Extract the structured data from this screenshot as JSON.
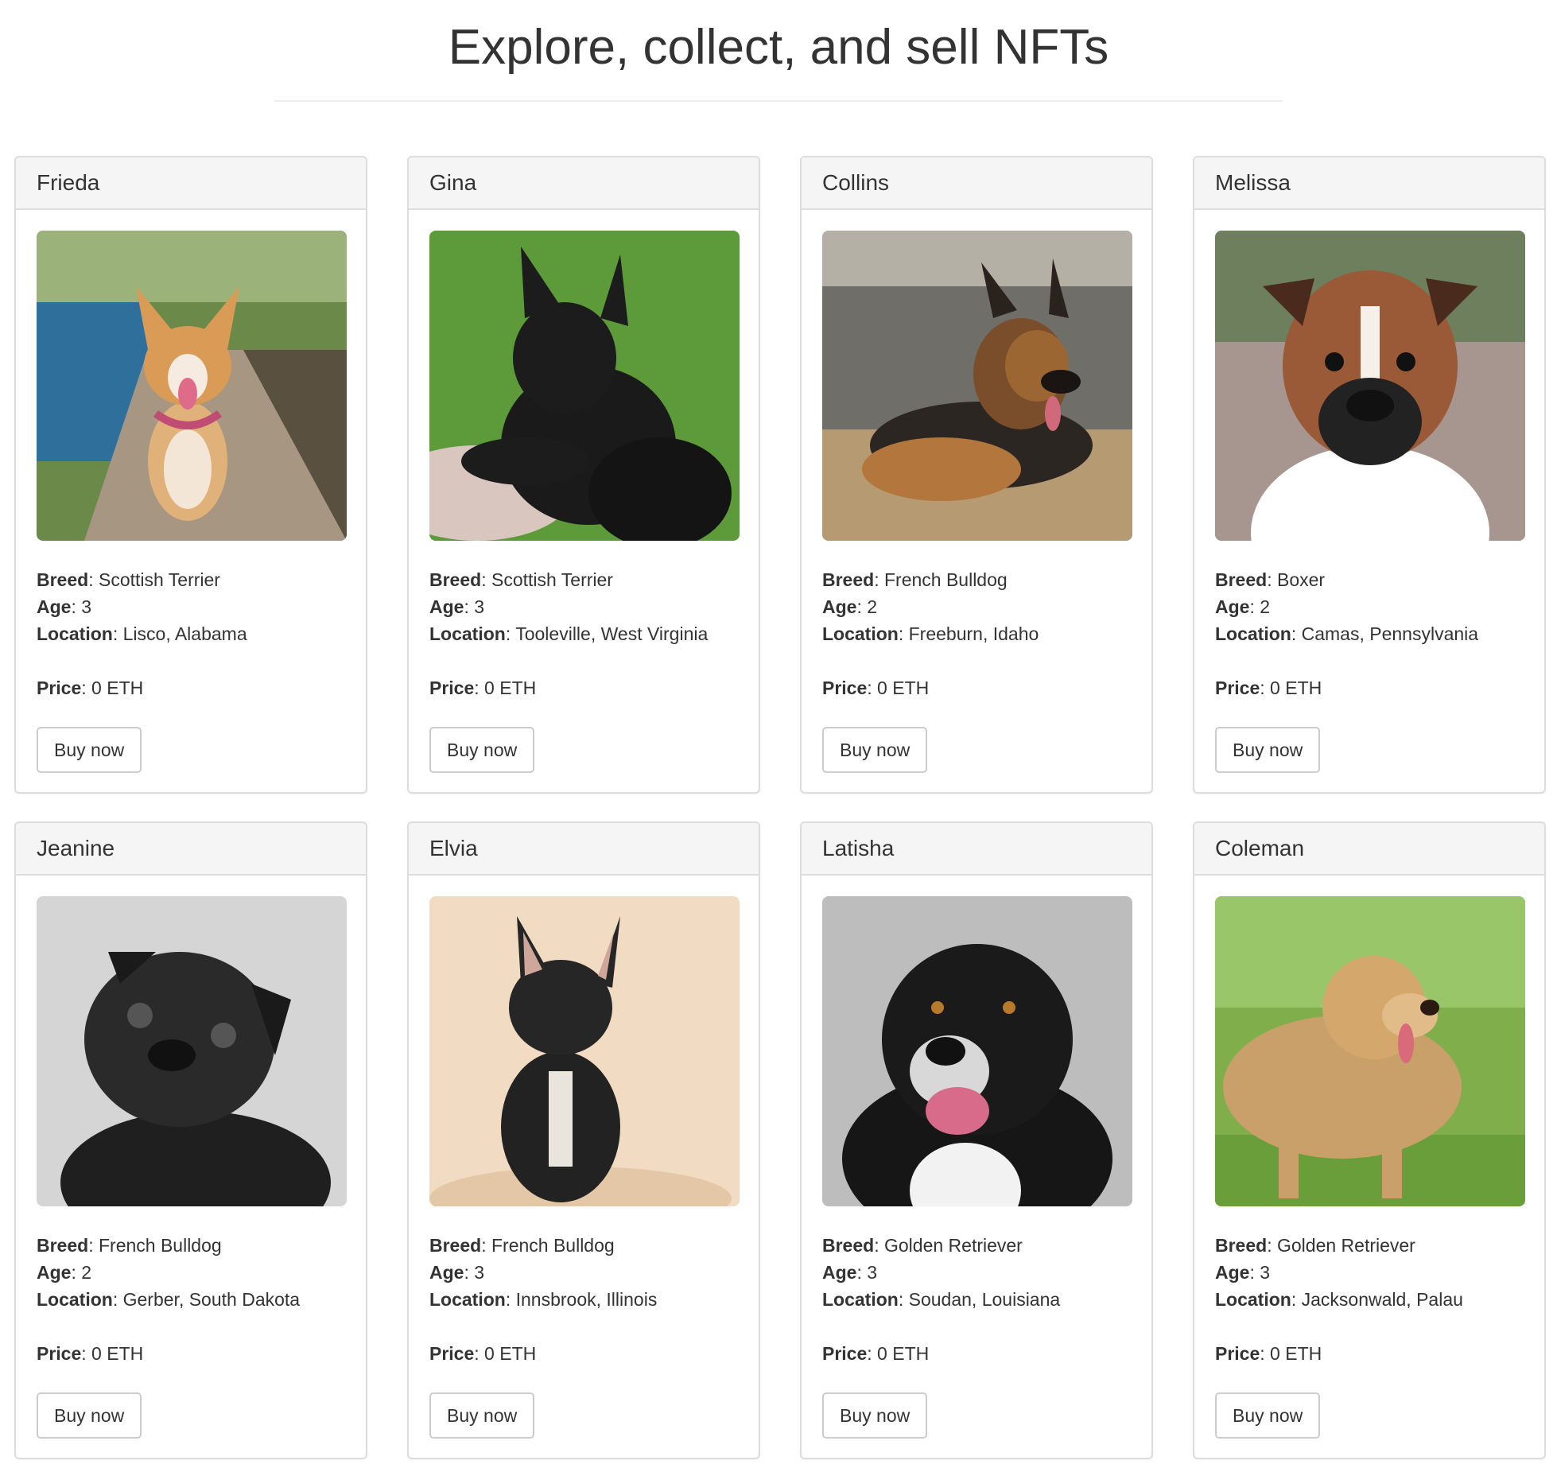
{
  "page": {
    "title": "Explore, collect, and sell NFTs"
  },
  "labels": {
    "breed": "Breed",
    "age": "Age",
    "location": "Location",
    "price": "Price",
    "sep": ": "
  },
  "cards": [
    {
      "name": "Frieda",
      "breed": "Scottish Terrier",
      "age": "3",
      "location": "Lisco, Alabama",
      "price": "0 ETH",
      "button": "Buy now",
      "image": "corgi-photo"
    },
    {
      "name": "Gina",
      "breed": "Scottish Terrier",
      "age": "3",
      "location": "Tooleville, West Virginia",
      "price": "0 ETH",
      "button": "Buy now",
      "image": "scottish-terrier-photo"
    },
    {
      "name": "Collins",
      "breed": "French Bulldog",
      "age": "2",
      "location": "Freeburn, Idaho",
      "price": "0 ETH",
      "button": "Buy now",
      "image": "german-shepherd-photo"
    },
    {
      "name": "Melissa",
      "breed": "Boxer",
      "age": "2",
      "location": "Camas, Pennsylvania",
      "price": "0 ETH",
      "button": "Buy now",
      "image": "boxer-photo"
    },
    {
      "name": "Jeanine",
      "breed": "French Bulldog",
      "age": "2",
      "location": "Gerber, South Dakota",
      "price": "0 ETH",
      "button": "Buy now",
      "image": "pug-photo"
    },
    {
      "name": "Elvia",
      "breed": "French Bulldog",
      "age": "3",
      "location": "Innsbrook, Illinois",
      "price": "0 ETH",
      "button": "Buy now",
      "image": "french-bulldog-photo"
    },
    {
      "name": "Latisha",
      "breed": "Golden Retriever",
      "age": "3",
      "location": "Soudan, Louisiana",
      "price": "0 ETH",
      "button": "Buy now",
      "image": "border-collie-photo"
    },
    {
      "name": "Coleman",
      "breed": "Golden Retriever",
      "age": "3",
      "location": "Jacksonwald, Palau",
      "price": "0 ETH",
      "button": "Buy now",
      "image": "golden-retriever-photo"
    }
  ],
  "colors": {
    "header_bg": "#f5f5f5",
    "border": "#dddddd",
    "text": "#333333"
  }
}
